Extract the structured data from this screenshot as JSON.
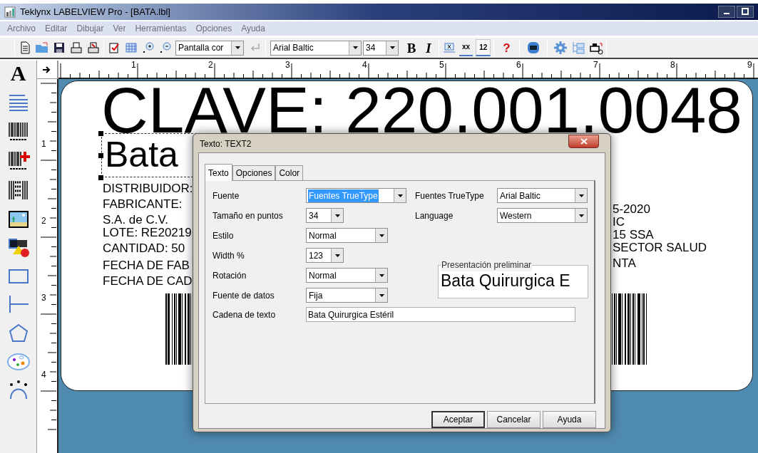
{
  "window": {
    "title": "Teklynx LABELVIEW Pro - [BATA.lbl]"
  },
  "menu": [
    "Archivo",
    "Editar",
    "Dibujar",
    "Ver",
    "Herramientas",
    "Opciones",
    "Ayuda"
  ],
  "toolbar": {
    "zoom_combo": "Pantalla cor",
    "font_combo": "Arial Baltic",
    "size_combo": "34",
    "bold": "B",
    "italic": "I",
    "counter_buttons": [
      {
        "text": "xx",
        "pressed": false
      },
      {
        "text": "12",
        "pressed": true
      }
    ],
    "help": "?"
  },
  "left_tools": {
    "text_tool": "A"
  },
  "rulers": {
    "horizontal": [
      "1",
      "2",
      "3",
      "4",
      "5",
      "6",
      "7",
      "8",
      "9"
    ],
    "vertical": [
      "1",
      "2",
      "3",
      "4"
    ]
  },
  "label": {
    "title": "CLAVE: 220.001.0048",
    "selected_text": {
      "text": "Bata",
      "selected": true
    },
    "left_lines": [
      "DISTRIBUIDOR:",
      "FABRICANTE:",
      "S.A. de C.V.",
      "LOTE: RE20219",
      "CANTIDAD: 50",
      "FECHA DE FAB",
      "FECHA DE CAD"
    ],
    "right_lines": [
      "5-2020",
      "IC",
      "15 SSA",
      "SECTOR SALUD",
      "NTA"
    ]
  },
  "dialog": {
    "title": "Texto: TEXT2",
    "tabs": [
      {
        "label": "Texto",
        "selected": true
      },
      {
        "label": "Opciones",
        "selected": false
      },
      {
        "label": "Color",
        "selected": false
      }
    ],
    "fields_left": [
      {
        "label": "Fuente",
        "value": "Fuentes TrueType",
        "kind": "wide",
        "highlighted": true
      },
      {
        "label": "Tamaño en puntos",
        "value": "34",
        "kind": "short",
        "highlighted": false
      },
      {
        "label": "Estilo",
        "value": "Normal",
        "kind": "long",
        "highlighted": false
      },
      {
        "label": "Width %",
        "value": "123",
        "kind": "short",
        "highlighted": false
      },
      {
        "label": "Rotación",
        "value": "Normal",
        "kind": "long",
        "highlighted": false
      },
      {
        "label": "Fuente de datos",
        "value": "Fija",
        "kind": "long",
        "highlighted": false
      }
    ],
    "fields_right": [
      {
        "label": "Fuentes TrueType",
        "value": "Arial Baltic"
      },
      {
        "label": "Language",
        "value": "Western"
      }
    ],
    "preview": {
      "legend": "Presentación preliminar",
      "text": "Bata Quirurgica E"
    },
    "text_string": {
      "label": "Cadena de texto",
      "value": "Bata Quirurgica Estéril"
    },
    "buttons": [
      "Aceptar",
      "Cancelar",
      "Ayuda"
    ]
  }
}
